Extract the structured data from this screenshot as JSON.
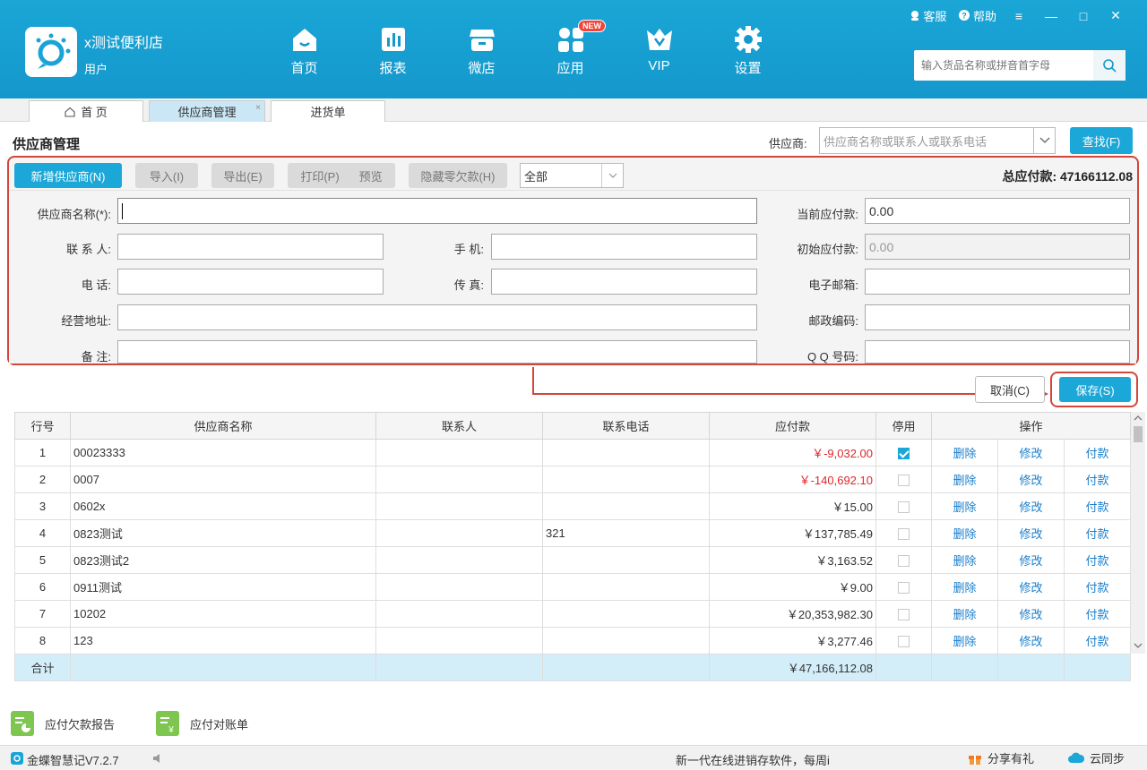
{
  "app": {
    "store_name": "x测试便利店",
    "user": "用户",
    "nav": [
      {
        "label": "首页",
        "icon": "home-icon"
      },
      {
        "label": "报表",
        "icon": "report-icon"
      },
      {
        "label": "微店",
        "icon": "shop-icon"
      },
      {
        "label": "应用",
        "icon": "apps-icon",
        "badge": "NEW"
      },
      {
        "label": "VIP",
        "icon": "vip-icon"
      },
      {
        "label": "设置",
        "icon": "settings-icon"
      }
    ],
    "service_label": "客服",
    "help_label": "帮助",
    "search_placeholder": "输入货品名称或拼音首字母"
  },
  "tabs": [
    {
      "label": "首 页",
      "active": false
    },
    {
      "label": "供应商管理",
      "active": true,
      "close": "×"
    },
    {
      "label": "进货单",
      "active": false
    }
  ],
  "page": {
    "title": "供应商管理",
    "supplier_label": "供应商:",
    "supplier_placeholder": "供应商名称或联系人或联系电话",
    "find_button": "查找(F)"
  },
  "toolbar": {
    "add": "新增供应商(N)",
    "import": "导入(I)",
    "export": "导出(E)",
    "print": "打印(P)",
    "preview": "预览",
    "hide_zero": "隐藏零欠款(H)",
    "filter_value": "全部",
    "total_label": "总应付款:",
    "total_value": "47166112.08"
  },
  "form": {
    "name_label": "供应商名称(*):",
    "contact_label": "联 系 人:",
    "mobile_label": "手    机:",
    "phone_label": "电    话:",
    "fax_label": "传    真:",
    "address_label": "经营地址:",
    "remark_label": "备    注:",
    "current_payable_label": "当前应付款:",
    "current_payable_value": "0.00",
    "initial_payable_label": "初始应付款:",
    "initial_payable_value": "0.00",
    "email_label": "电子邮箱:",
    "postcode_label": "邮政编码:",
    "qq_label": "Q Q 号码:",
    "cancel_button": "取消(C)",
    "save_button": "保存(S)"
  },
  "table": {
    "headers": [
      "行号",
      "供应商名称",
      "联系人",
      "联系电话",
      "应付款",
      "停用",
      "操作"
    ],
    "rows": [
      {
        "no": "1",
        "name": "00023333",
        "contact": "",
        "phone": "",
        "payable": "￥-9,032.00",
        "neg": true,
        "disabled": true
      },
      {
        "no": "2",
        "name": "0007",
        "contact": "",
        "phone": "",
        "payable": "￥-140,692.10",
        "neg": true,
        "disabled": false
      },
      {
        "no": "3",
        "name": "0602x",
        "contact": "",
        "phone": "",
        "payable": "￥15.00",
        "neg": false,
        "disabled": false
      },
      {
        "no": "4",
        "name": "0823测试",
        "contact": "",
        "phone": "321",
        "payable": "￥137,785.49",
        "neg": false,
        "disabled": false
      },
      {
        "no": "5",
        "name": "0823测试2",
        "contact": "",
        "phone": "",
        "payable": "￥3,163.52",
        "neg": false,
        "disabled": false
      },
      {
        "no": "6",
        "name": "0911测试",
        "contact": "",
        "phone": "",
        "payable": "￥9.00",
        "neg": false,
        "disabled": false
      },
      {
        "no": "7",
        "name": "10202",
        "contact": "",
        "phone": "",
        "payable": "￥20,353,982.30",
        "neg": false,
        "disabled": false
      },
      {
        "no": "8",
        "name": "123",
        "contact": "",
        "phone": "",
        "payable": "￥3,277.46",
        "neg": false,
        "disabled": false
      }
    ],
    "actions": [
      "删除",
      "修改",
      "付款"
    ],
    "sum_label": "合计",
    "sum_value": "￥47,166,112.08"
  },
  "reports": [
    "应付欠款报告",
    "应付对账单"
  ],
  "status": {
    "version": "金蝶智慧记V7.2.7",
    "marquee": "新一代在线进销存软件，每周i",
    "share": "分享有礼",
    "cloud": "云同步"
  },
  "colors": {
    "primary": "#1ba7d8",
    "header": "#1598cc",
    "highlight_border": "#d3463a",
    "negative": "#e0262a",
    "link": "#1a7ecb"
  }
}
